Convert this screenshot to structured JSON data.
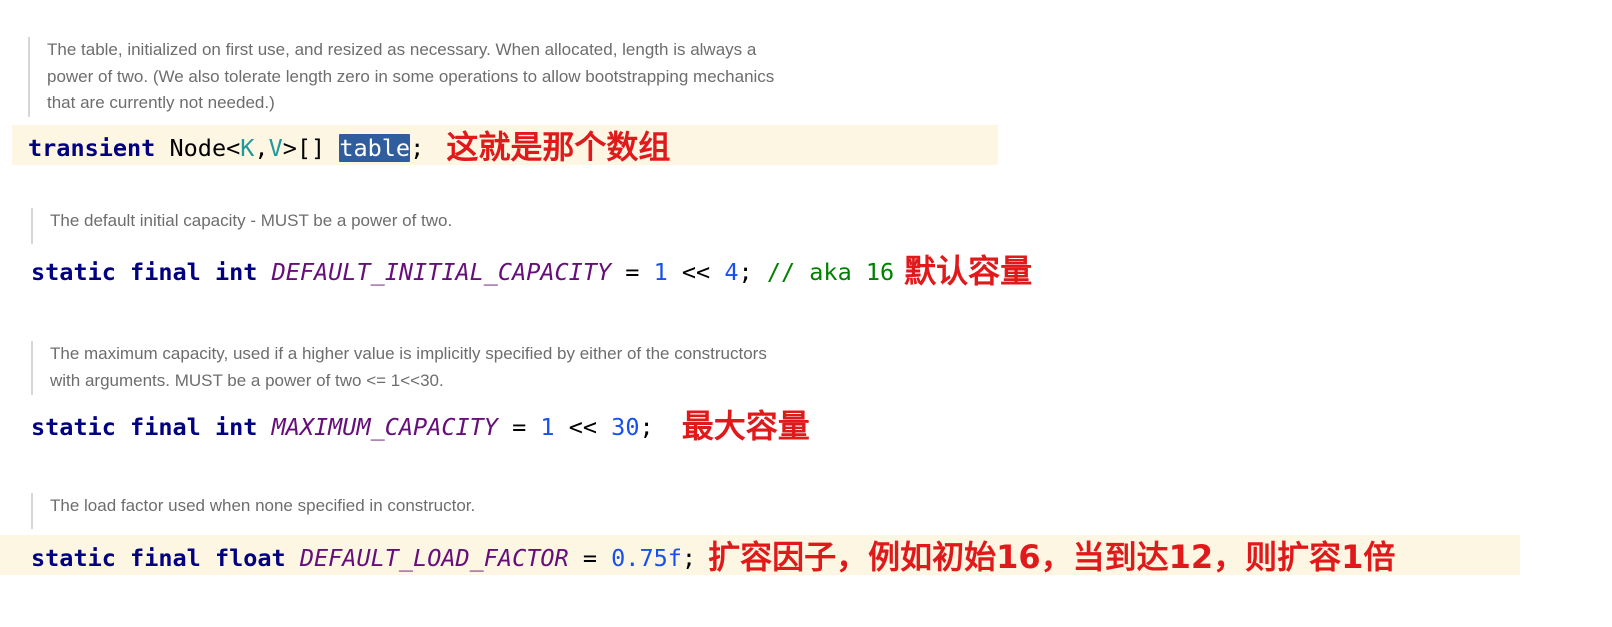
{
  "blocks": [
    {
      "doc": [
        "The table, initialized on first use, and resized as necessary. When allocated, length is always a",
        "power of two. (We also tolerate length zero in some operations to allow bootstrapping mechanics",
        "that are currently not needed.)"
      ],
      "code": {
        "keyword": "transient",
        "type": "Node",
        "lt": "<",
        "param1": "K",
        "comma": ",",
        "param2": "V",
        "gt_brackets": ">[]",
        "field": "table",
        "semicolon": ";"
      },
      "note": "这就是那个数组"
    },
    {
      "doc": [
        "The default initial capacity - MUST be a power of two."
      ],
      "code": {
        "kw1": "static",
        "kw2": "final",
        "kw3": "int",
        "field": "DEFAULT_INITIAL_CAPACITY",
        "eq": "=",
        "num1": "1",
        "op": "<<",
        "num2": "4",
        "semicolon": ";",
        "comment": "// aka 16"
      },
      "note": "默认容量"
    },
    {
      "doc": [
        "The maximum capacity, used if a higher value is implicitly specified by either of the constructors",
        "with arguments. MUST be a power of two <= 1<<30."
      ],
      "code": {
        "kw1": "static",
        "kw2": "final",
        "kw3": "int",
        "field": "MAXIMUM_CAPACITY",
        "eq": "=",
        "num1": "1",
        "op": "<<",
        "num2": "30",
        "semicolon": ";"
      },
      "note": "最大容量"
    },
    {
      "doc": [
        "The load factor used when none specified in constructor."
      ],
      "code": {
        "kw1": "static",
        "kw2": "final",
        "kw3": "float",
        "field": "DEFAULT_LOAD_FACTOR",
        "eq": "=",
        "num1": "0.75f",
        "semicolon": ";"
      },
      "note": "扩容因子，例如初始16，当到达12，则扩容1倍"
    }
  ]
}
